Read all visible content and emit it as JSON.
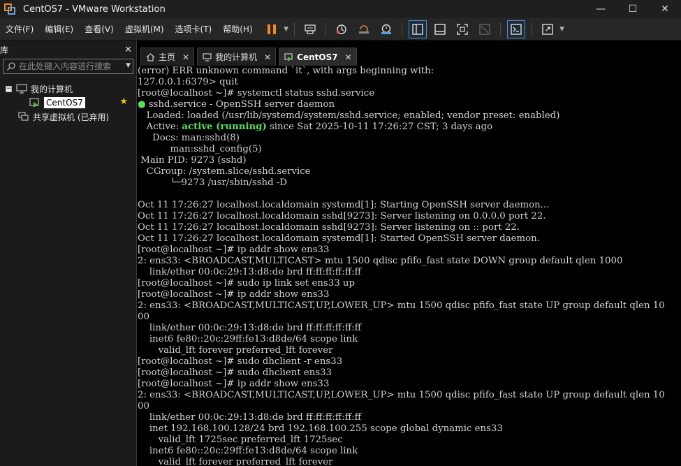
{
  "window": {
    "title": "CentOS7 - VMware Workstation",
    "controls": [
      "—",
      "☐",
      "✕"
    ]
  },
  "menu": {
    "items": [
      "文件(F)",
      "编辑(E)",
      "查看(V)",
      "虚拟机(M)",
      "选项卡(T)",
      "帮助(H)"
    ]
  },
  "toolbar": {
    "icons": [
      "pause-icon",
      "send-keys-icon",
      "snapshot-icon",
      "revert-snapshot-icon",
      "snapshot-manager-icon",
      "library-view-icon",
      "single-window-icon",
      "fullscreen-icon",
      "unity-icon",
      "console-icon",
      "stretch-icon"
    ],
    "accent_color": "#f08a24"
  },
  "library": {
    "title": "库",
    "close": "✕",
    "search_placeholder": "在此处键入内容进行搜索",
    "tree": {
      "root_toggle": "−",
      "root_label": "我的计算机",
      "vm_label": "CentOS7",
      "shared_label": "共享虚拟机 (已弃用)",
      "star": "★"
    }
  },
  "tabs": [
    {
      "label": "主页",
      "icon": "home-icon"
    },
    {
      "label": "我的计算机",
      "icon": "computer-icon"
    },
    {
      "label": "CentOS7",
      "icon": "vm-icon"
    }
  ],
  "tab_close": "✕",
  "terminal": {
    "lines": [
      "(error) ERR unknown command `it`, with args beginning with:",
      "127.0.0.1:6379> quit",
      "[root@localhost ~]# systemctl status sshd.service",
      "",
      "   Loaded: loaded (/usr/lib/systemd/system/sshd.service; enabled; vendor preset: enabled)",
      "",
      "     Docs: man:sshd(8)",
      "           man:sshd_config(5)",
      " Main PID: 9273 (sshd)",
      "   CGroup: /system.slice/sshd.service",
      "           └─9273 /usr/sbin/sshd -D",
      "",
      "Oct 11 17:26:27 localhost.localdomain systemd[1]: Starting OpenSSH server daemon...",
      "Oct 11 17:26:27 localhost.localdomain sshd[9273]: Server listening on 0.0.0.0 port 22.",
      "Oct 11 17:26:27 localhost.localdomain sshd[9273]: Server listening on :: port 22.",
      "Oct 11 17:26:27 localhost.localdomain systemd[1]: Started OpenSSH server daemon.",
      "[root@localhost ~]# ip addr show ens33",
      "2: ens33: <BROADCAST,MULTICAST> mtu 1500 qdisc pfifo_fast state DOWN group default qlen 1000",
      "    link/ether 00:0c:29:13:d8:de brd ff:ff:ff:ff:ff:ff",
      "[root@localhost ~]# sudo ip link set ens33 up",
      "[root@localhost ~]# ip addr show ens33",
      "2: ens33: <BROADCAST,MULTICAST,UP,LOWER_UP> mtu 1500 qdisc pfifo_fast state UP group default qlen 10",
      "00",
      "    link/ether 00:0c:29:13:d8:de brd ff:ff:ff:ff:ff:ff",
      "    inet6 fe80::20c:29ff:fe13:d8de/64 scope link",
      "       valid_lft forever preferred_lft forever",
      "[root@localhost ~]# sudo dhclient -r ens33",
      "[root@localhost ~]# sudo dhclient ens33",
      "[root@localhost ~]# ip addr show ens33",
      "2: ens33: <BROADCAST,MULTICAST,UP,LOWER_UP> mtu 1500 qdisc pfifo_fast state UP group default qlen 10",
      "00",
      "    link/ether 00:0c:29:13:d8:de brd ff:ff:ff:ff:ff:ff",
      "    inet 192.168.100.128/24 brd 192.168.100.255 scope global dynamic ens33",
      "       valid_lft 1725sec preferred_lft 1725sec",
      "    inet6 fe80::20c:29ff:fe13:d8de/64 scope link",
      "       valid_lft forever preferred_lft forever"
    ],
    "service_line": {
      "dot": "●",
      "text": " sshd.service - OpenSSH server daemon"
    },
    "active_line": {
      "prefix": "   Active: ",
      "status": "active (running)",
      "suffix": " since Sat 2025-10-11 17:26:27 CST; 3 days ago"
    },
    "status_color": "#55e05a"
  }
}
